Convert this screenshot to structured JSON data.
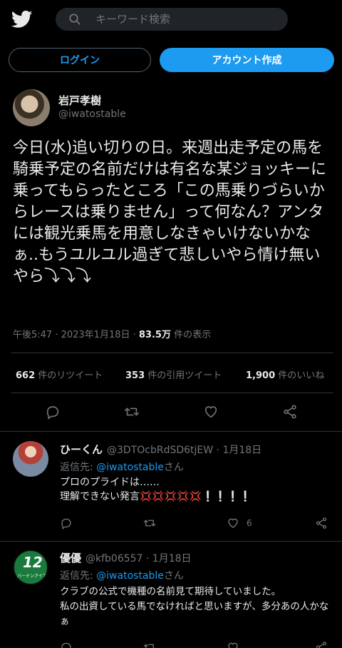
{
  "header": {
    "search_placeholder": "キーワード検索",
    "login_label": "ログイン",
    "signup_label": "アカウント作成"
  },
  "tweet": {
    "author_name": "岩戸孝樹",
    "author_handle": "@iwatostable",
    "text": "今日(水)追い切りの日。来週出走予定の馬を騎乗予定の名前だけは有名な某ジョッキーに乗ってもらったところ「この馬乗りづらいからレースは乗りません」って何なん？アンタには観光乗馬を用意しなきゃいけないかなぁ..もうユルユル過ぎて悲しいやら情け無いやら⤵︎⤵︎⤵︎",
    "time": "午後5:47 · 2023年1月18日 · ",
    "views_count": "83.5万",
    "views_label": " 件の表示",
    "retweets_count": "662",
    "retweets_label": " 件のリツイート",
    "quotes_count": "353",
    "quotes_label": " 件の引用ツイート",
    "likes_count": "1,900",
    "likes_label": " 件のいいね"
  },
  "replies": [
    {
      "name": "ひーくん",
      "handle_date": "@3DTOcbRdSD6tjEW · 1月18日",
      "reply_prefix": "返信先: ",
      "reply_mention": "@iwatostable",
      "reply_suffix": "さん",
      "text": "プロのプライドは……\n理解できない発言💢💢💢💢💢❕❕❕❕",
      "like_count": "6"
    },
    {
      "name": "優優",
      "handle_date": "@kfb06557 · 1月18日",
      "reply_prefix": "返信先: ",
      "reply_mention": "@iwatostable",
      "reply_suffix": "さん",
      "text": "クラブの公式で機種の名前見て期待していました。\n私の出資している馬でなければと思いますが、多分あの人かなぁ",
      "like_count": "",
      "avatar_number": "12",
      "avatar_caption": "バーテンアイアー"
    }
  ],
  "icons": [
    "twitter-logo",
    "search-icon",
    "reply-icon",
    "retweet-icon",
    "like-icon",
    "share-icon"
  ],
  "colors": {
    "accent": "#1d9bf0",
    "background": "#000000",
    "muted": "#71767b",
    "divider": "#2f3336"
  }
}
